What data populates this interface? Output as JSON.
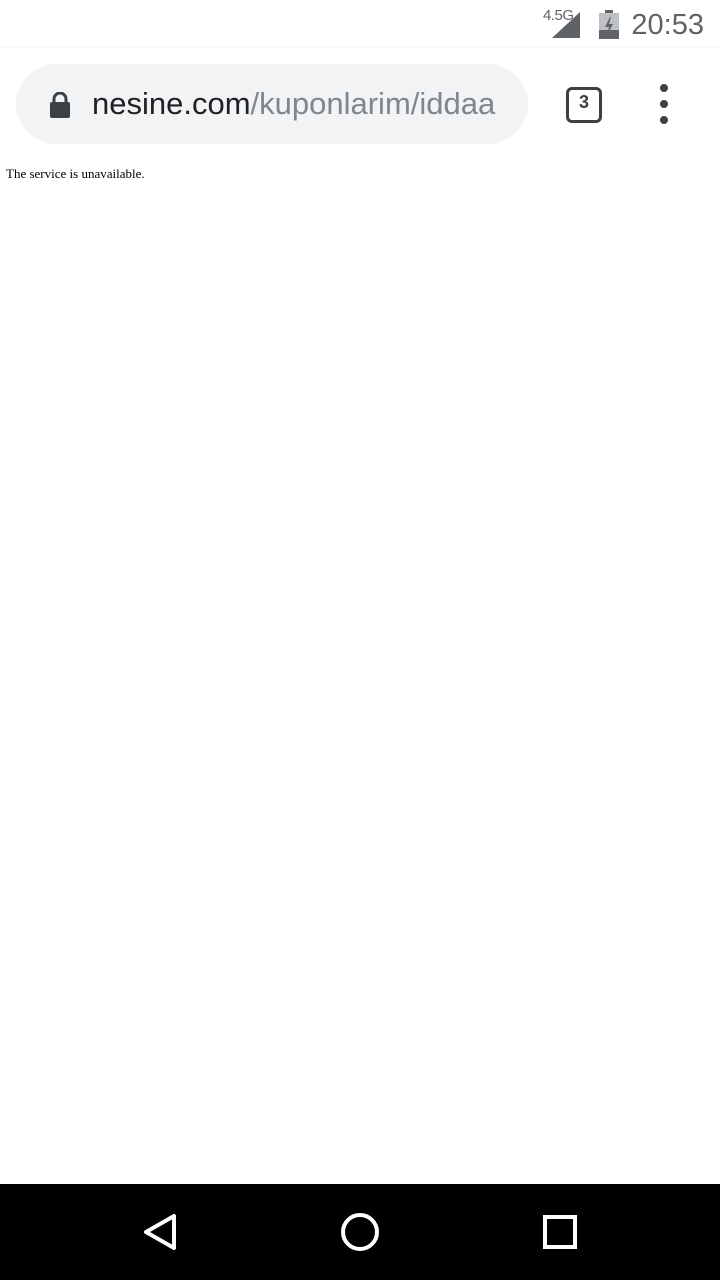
{
  "status_bar": {
    "network": "4.5G",
    "time": "20:53",
    "icons": [
      "signal-icon",
      "battery-charging-icon"
    ]
  },
  "browser": {
    "url_host": "nesine.com",
    "url_path": "/kuponlarim/iddaa",
    "tab_count": "3",
    "icons": [
      "lock-icon",
      "tab-switcher-icon",
      "more-vert-icon"
    ]
  },
  "page": {
    "message": "The service is unavailable."
  },
  "nav_bar": {
    "icons": [
      "back-icon",
      "home-icon",
      "recents-icon"
    ]
  },
  "colors": {
    "status_text": "#5f6368",
    "omnibox_bg": "#f1f3f4",
    "url_host": "#202124",
    "url_path": "#80868b",
    "nav_bar_bg": "#000000"
  }
}
